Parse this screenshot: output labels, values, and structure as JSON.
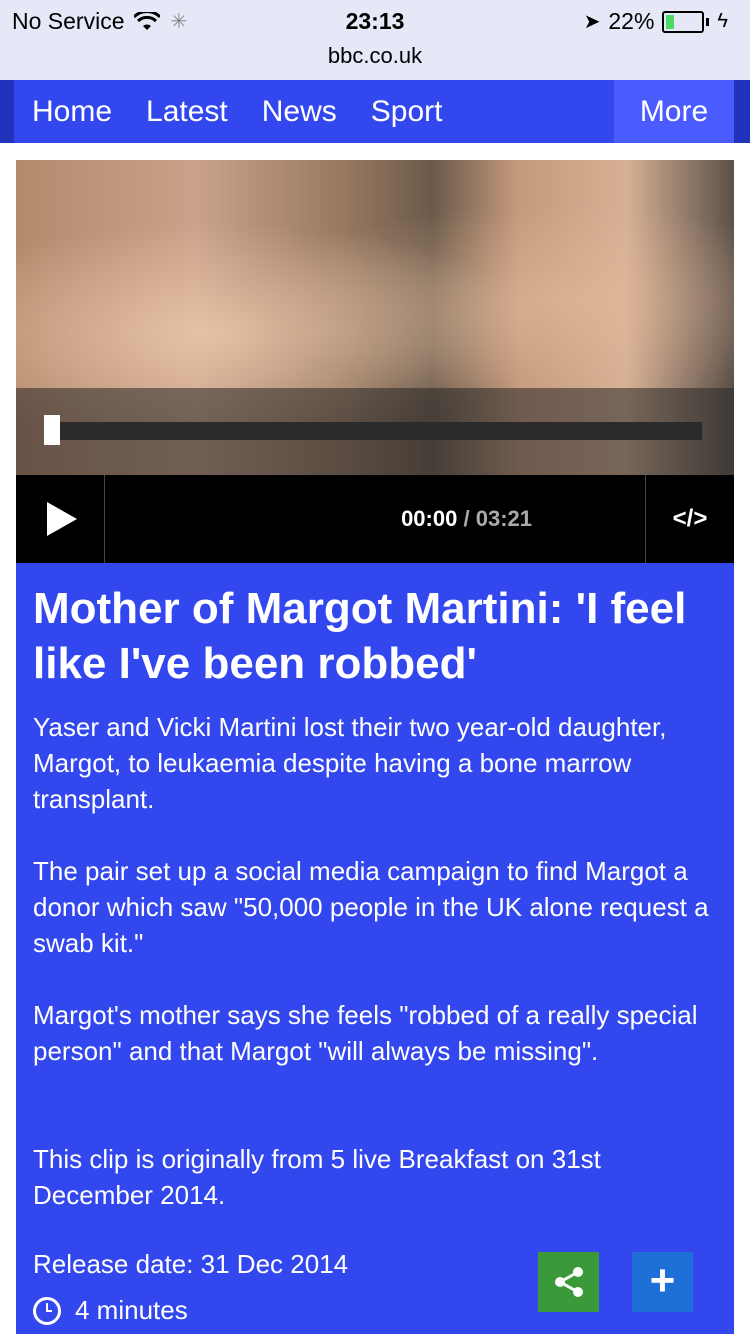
{
  "status_bar": {
    "carrier": "No Service",
    "time": "23:13",
    "url": "bbc.co.uk",
    "battery": "22%"
  },
  "nav": {
    "items": [
      "Home",
      "Latest",
      "News",
      "Sport"
    ],
    "more": "More"
  },
  "player": {
    "current_time": "00:00",
    "separator": "/",
    "duration": "03:21",
    "embed_icon": "code-embed-icon",
    "progress": 0
  },
  "article": {
    "headline": "Mother of Margot Martini: 'I feel like I've been robbed'",
    "paragraphs": [
      "Yaser and Vicki Martini lost their two year-old daughter, Margot, to leukaemia despite having a bone marrow transplant.",
      "The pair set up a social media campaign to find Margot a donor which saw \"50,000 people in the UK alone request a swab kit.\"",
      "Margot's mother says she feels \"robbed of a really special person\" and that Margot \"will always be missing\".",
      "This clip is originally from 5 live Breakfast on 31st December 2014."
    ],
    "release_date": "Release date: 31 Dec 2014",
    "duration": "4 minutes"
  },
  "colors": {
    "nav_bg": "#3347ee",
    "article_bg": "#3347ee",
    "share_bg": "#3a9a3a",
    "add_bg": "#1f6fd8"
  }
}
